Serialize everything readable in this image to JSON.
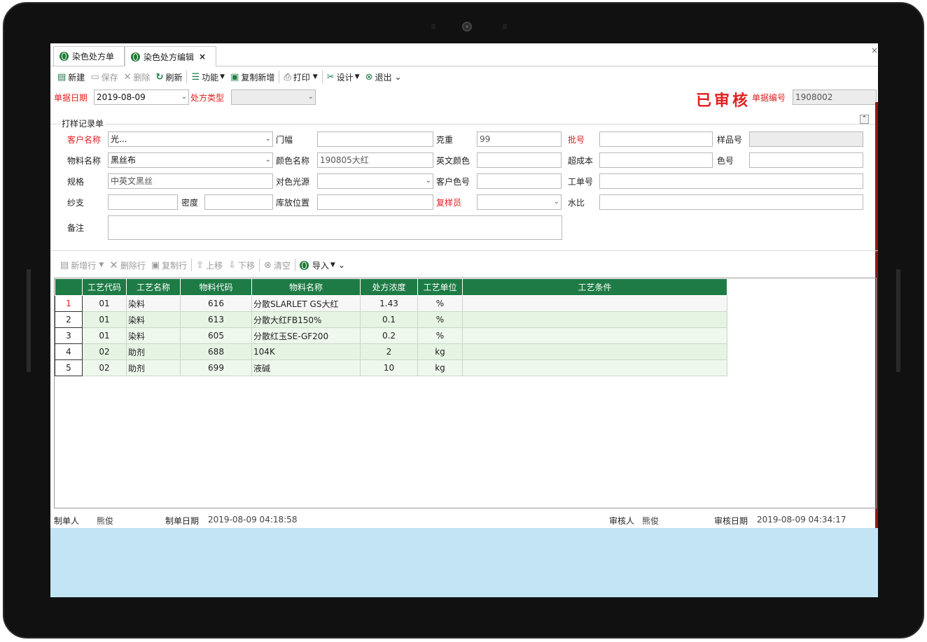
{
  "tabs": [
    {
      "label": "染色处方单"
    },
    {
      "label": "染色处方编辑",
      "close": "×"
    }
  ],
  "window_close": "×",
  "toolbar": {
    "new": "新建",
    "save": "保存",
    "delete": "删除",
    "refresh": "刷新",
    "function": "功能",
    "copy_new": "复制新增",
    "print": "打印",
    "design": "设计",
    "exit": "退出"
  },
  "header": {
    "date_label": "单据日期",
    "date_value": "2019-08-09",
    "type_label": "处方类型",
    "type_value": "",
    "audit_status": "已审核",
    "doc_no_label": "单据编号",
    "doc_no_value": "1908002"
  },
  "group": {
    "title": "打样记录单",
    "customer_label": "客户名称",
    "customer_value": "光...",
    "width_label": "门幅",
    "width_value": "",
    "weight_label": "克重",
    "weight_value": "99",
    "batch_label": "批号",
    "batch_value": "",
    "sample_label": "样品号",
    "sample_value": "",
    "material_label": "物料名称",
    "material_value": "黑丝布",
    "color_label": "颜色名称",
    "color_value": "190805大红",
    "en_color_label": "英文颜色",
    "en_color_value": "",
    "over_cost_label": "超成本",
    "over_cost_value": "",
    "color_no_label": "色号",
    "color_no_value": "",
    "spec_label": "规格",
    "spec_value": "中英文黑丝",
    "light_label": "对色光源",
    "light_value": "",
    "cust_color_label": "客户色号",
    "cust_color_value": "",
    "work_no_label": "工单号",
    "work_no_value": "",
    "yarn_label": "纱支",
    "yarn_value": "",
    "density_label": "密度",
    "density_value": "",
    "location_label": "库放位置",
    "location_value": "",
    "recheck_label": "复样员",
    "recheck_value": "",
    "water_label": "水比",
    "water_value": "",
    "remark_label": "备注",
    "remark_value": ""
  },
  "grid_toolbar": {
    "add_row": "新增行",
    "del_row": "删除行",
    "copy_row": "复制行",
    "move_up": "上移",
    "move_down": "下移",
    "clear": "清空",
    "import": "导入"
  },
  "grid": {
    "headers": [
      "工艺代码",
      "工艺名称",
      "物料代码",
      "物料名称",
      "处方浓度",
      "工艺单位",
      "工艺条件"
    ],
    "rows": [
      {
        "n": "1",
        "code": "01",
        "name": "染料",
        "mat": "616",
        "mat_name": "分散SLARLET GS大红",
        "conc": "1.43",
        "unit": "%",
        "cond": ""
      },
      {
        "n": "2",
        "code": "01",
        "name": "染料",
        "mat": "613",
        "mat_name": "分散大红FB150%",
        "conc": "0.1",
        "unit": "%",
        "cond": ""
      },
      {
        "n": "3",
        "code": "01",
        "name": "染料",
        "mat": "605",
        "mat_name": "分散红玉SE-GF200",
        "conc": "0.2",
        "unit": "%",
        "cond": ""
      },
      {
        "n": "4",
        "code": "02",
        "name": "助剂",
        "mat": "688",
        "mat_name": "104K",
        "conc": "2",
        "unit": "kg",
        "cond": ""
      },
      {
        "n": "5",
        "code": "02",
        "name": "助剂",
        "mat": "699",
        "mat_name": "液碱",
        "conc": "10",
        "unit": "kg",
        "cond": ""
      }
    ]
  },
  "footer": {
    "maker_label": "制单人",
    "maker_value": "熊俊",
    "make_date_label": "制单日期",
    "make_date_value": "2019-08-09 04:18:58",
    "auditor_label": "审核人",
    "auditor_value": "熊俊",
    "audit_date_label": "审核日期",
    "audit_date_value": "2019-08-09 04:34:17"
  },
  "colors": {
    "accent_green": "#1e7b45",
    "required_red": "#e0201f",
    "bottom_blue": "#c3e4f3"
  }
}
